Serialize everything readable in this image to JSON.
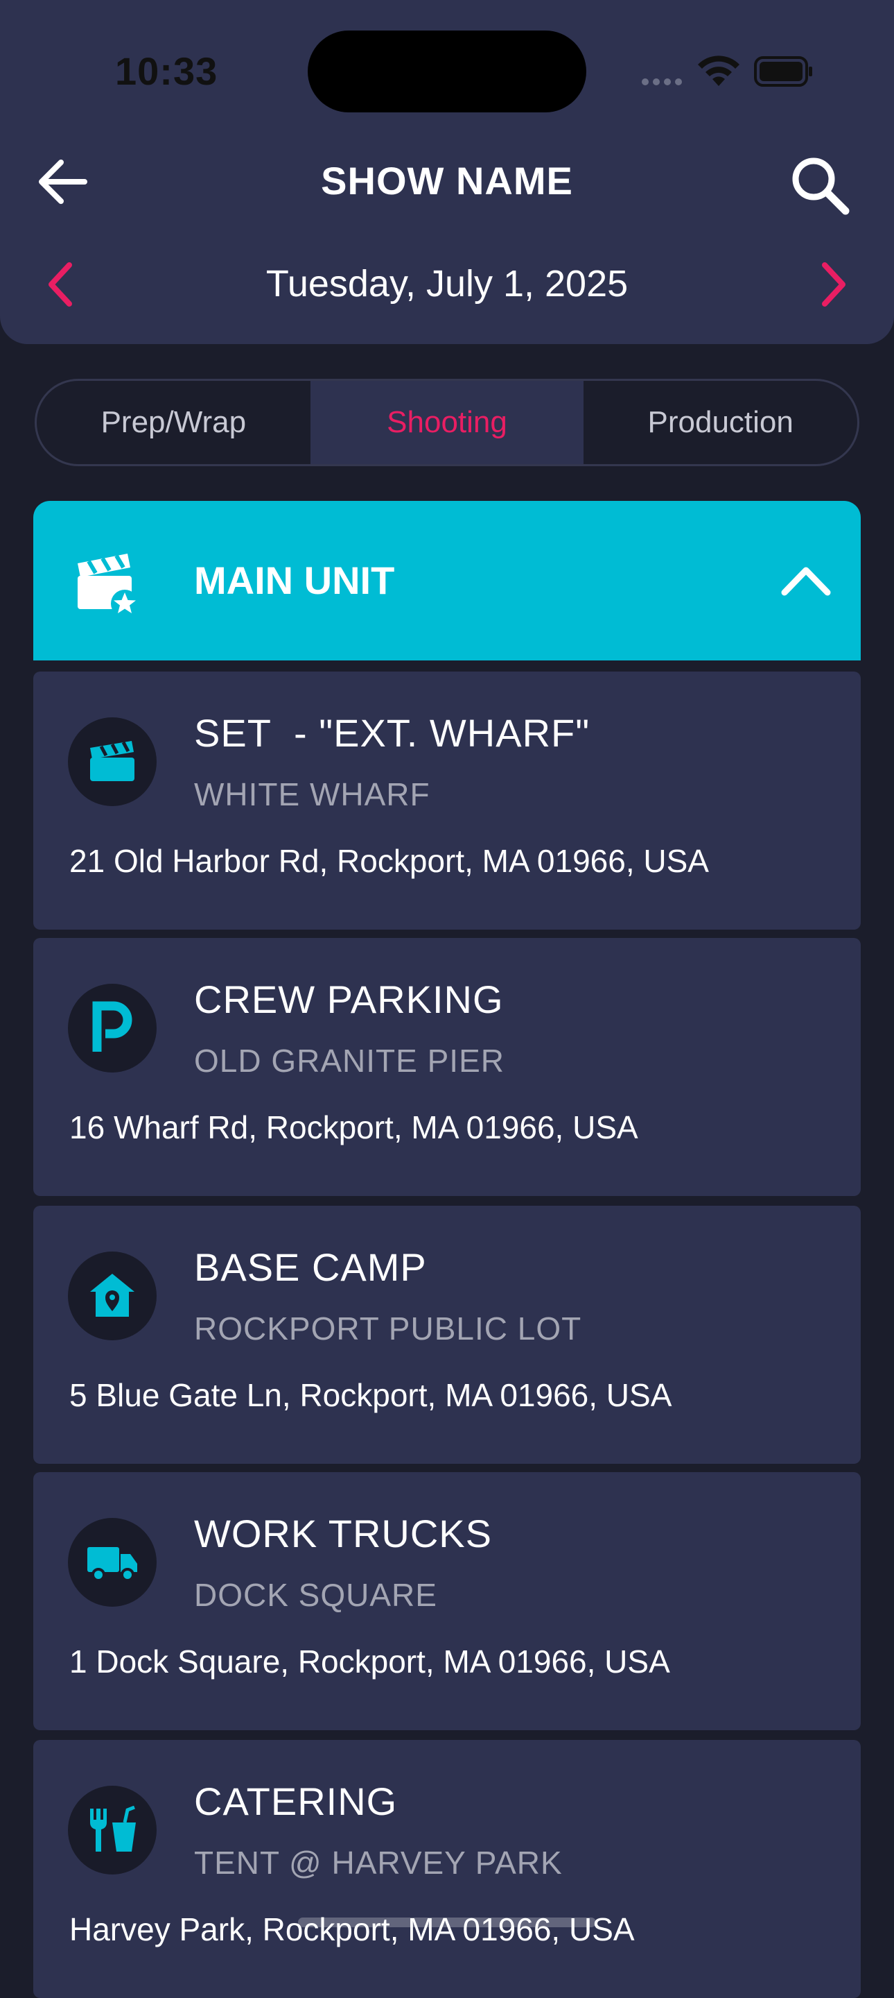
{
  "status_bar": {
    "time": "10:33"
  },
  "header": {
    "title": "SHOW NAME",
    "date": "Tuesday, July 1, 2025"
  },
  "tabs": [
    {
      "label": "Prep/Wrap",
      "active": false
    },
    {
      "label": "Shooting",
      "active": true
    },
    {
      "label": "Production",
      "active": false
    }
  ],
  "unit": {
    "title": "MAIN UNIT",
    "expanded": true
  },
  "locations": [
    {
      "icon": "clapperboard-icon",
      "title": "SET  - \"EXT. WHARF\"",
      "subtitle": "WHITE WHARF",
      "address": "21 Old Harbor Rd, Rockport, MA 01966, USA"
    },
    {
      "icon": "parking-icon",
      "title": "CREW PARKING",
      "subtitle": "OLD GRANITE PIER",
      "address": "16 Wharf Rd, Rockport, MA 01966, USA"
    },
    {
      "icon": "home-pin-icon",
      "title": "BASE CAMP",
      "subtitle": "ROCKPORT PUBLIC LOT",
      "address": "5 Blue Gate Ln, Rockport, MA 01966, USA"
    },
    {
      "icon": "truck-icon",
      "title": "WORK TRUCKS",
      "subtitle": "DOCK SQUARE",
      "address": "1 Dock Square, Rockport, MA 01966, USA"
    },
    {
      "icon": "food-drink-icon",
      "title": "CATERING",
      "subtitle": "TENT @ HARVEY PARK",
      "address": "Harvey Park, Rockport, MA 01966, USA"
    }
  ],
  "colors": {
    "accent_pink": "#e91e63",
    "accent_cyan": "#00bcd4",
    "card_bg": "#2e3250",
    "page_bg": "#1b1d2b"
  }
}
